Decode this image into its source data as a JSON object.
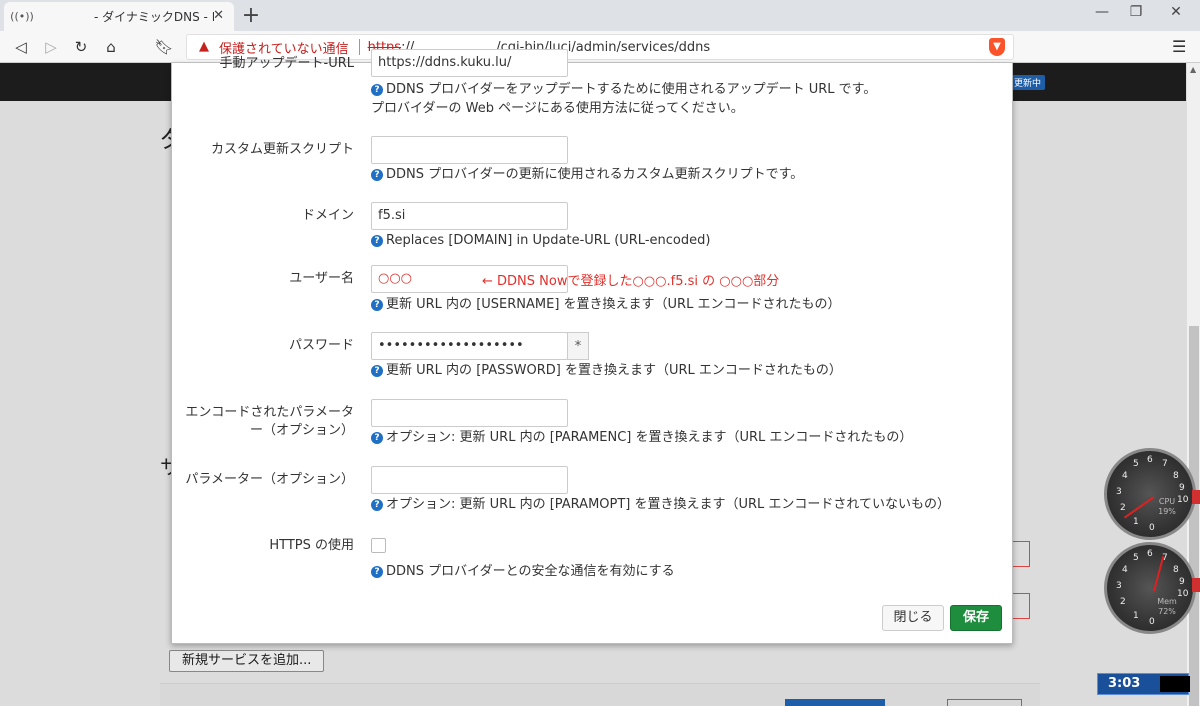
{
  "browser": {
    "tab_title": "- ダイナミックDNS - LuCI",
    "new_tab": "+",
    "security_warning": "保護されていない通信",
    "url_scheme": "https",
    "url_sep": "://",
    "url_path": "/cgi-bin/luci/admin/services/ddns"
  },
  "background": {
    "status_badge": "更新中",
    "add_service_button": "新規サービスを追加..."
  },
  "form": {
    "update_url": {
      "label": "手動アップデート-URL",
      "value": "https://ddns.kuku.lu/",
      "help_line1": "DDNS プロバイダーをアップデートするために使用されるアップデート URL です。",
      "help_line2": "プロバイダーの Web ページにある使用方法に従ってください。"
    },
    "custom_script": {
      "label": "カスタム更新スクリプト",
      "value": "",
      "help": "DDNS プロバイダーの更新に使用されるカスタム更新スクリプトです。"
    },
    "domain": {
      "label": "ドメイン",
      "value": "f5.si",
      "help": "Replaces [DOMAIN] in Update-URL (URL-encoded)"
    },
    "username": {
      "label": "ユーザー名",
      "value": "○○○",
      "annotation": "← DDNS Nowで登録した○○○.f5.si の ○○○部分",
      "help": "更新 URL 内の [USERNAME] を置き換えます（URL エンコードされたもの）"
    },
    "password": {
      "label": "パスワード",
      "value": "•••••••••••••••••••",
      "reveal": "*",
      "help": "更新 URL 内の [PASSWORD] を置き換えます（URL エンコードされたもの）"
    },
    "param_enc": {
      "label_line1": "エンコードされたパラメータ",
      "label_line2": "ー（オプション）",
      "value": "",
      "help": "オプション: 更新 URL 内の [PARAMENC] を置き換えます（URL エンコードされたもの）"
    },
    "param_opt": {
      "label": "パラメーター（オプション）",
      "value": "",
      "help": "オプション: 更新 URL 内の [PARAMOPT] を置き換えます（URL エンコードされていないもの）"
    },
    "use_https": {
      "label": "HTTPS の使用",
      "checked": false,
      "help": "DDNS プロバイダーとの安全な通信を有効にする"
    }
  },
  "buttons": {
    "close": "閉じる",
    "save": "保存"
  },
  "gadgets": {
    "cpu_label": "CPU",
    "cpu_percent": "19%",
    "mem_label": "Mem",
    "mem_percent": "72%",
    "clock": "3:03"
  },
  "colors": {
    "accent_red": "#e0302b",
    "save_green": "#1e8e3e",
    "help_blue": "#1f6fc5"
  }
}
